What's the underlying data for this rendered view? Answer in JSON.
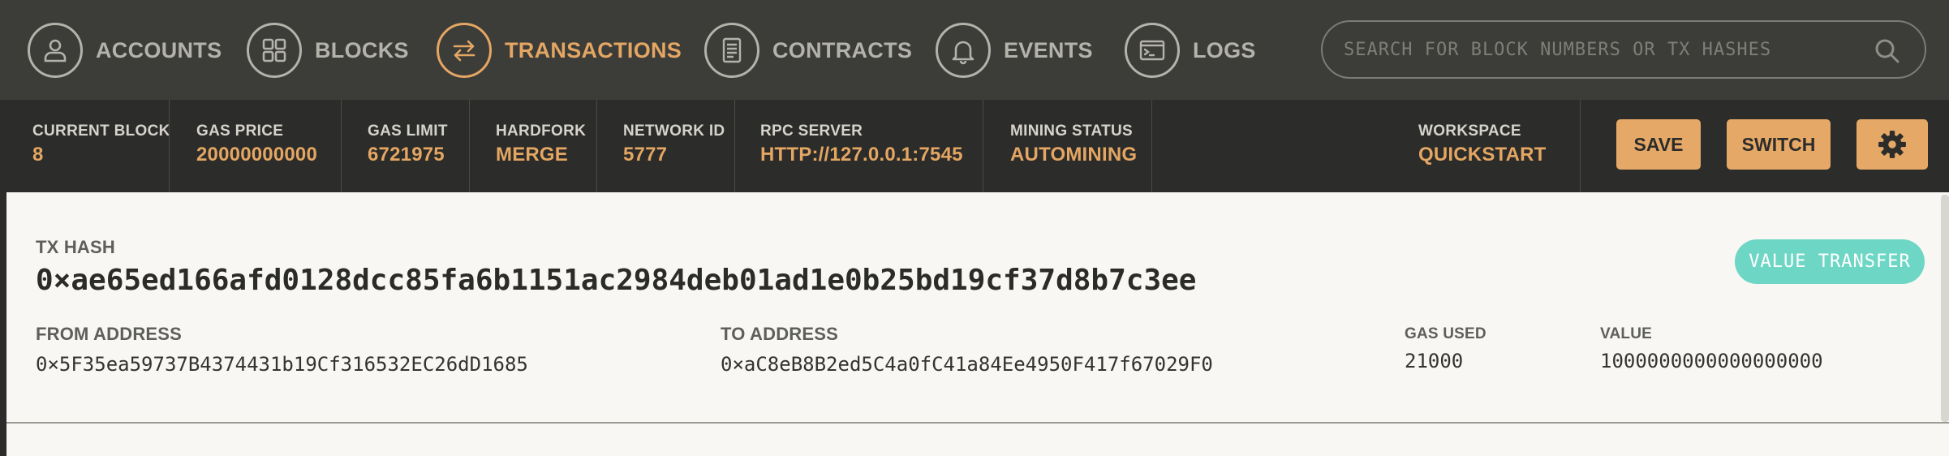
{
  "nav": {
    "items": [
      {
        "label": "ACCOUNTS",
        "icon": "person-icon",
        "active": false
      },
      {
        "label": "BLOCKS",
        "icon": "grid-icon",
        "active": false
      },
      {
        "label": "TRANSACTIONS",
        "icon": "swap-arrows-icon",
        "active": true
      },
      {
        "label": "CONTRACTS",
        "icon": "document-icon",
        "active": false
      },
      {
        "label": "EVENTS",
        "icon": "bell-icon",
        "active": false
      },
      {
        "label": "LOGS",
        "icon": "terminal-icon",
        "active": false
      }
    ],
    "search_placeholder": "SEARCH FOR BLOCK NUMBERS OR TX HASHES"
  },
  "status": {
    "current_block": {
      "label": "CURRENT BLOCK",
      "value": "8"
    },
    "gas_price": {
      "label": "GAS PRICE",
      "value": "20000000000"
    },
    "gas_limit": {
      "label": "GAS LIMIT",
      "value": "6721975"
    },
    "hardfork": {
      "label": "HARDFORK",
      "value": "MERGE"
    },
    "network_id": {
      "label": "NETWORK ID",
      "value": "5777"
    },
    "rpc_server": {
      "label": "RPC SERVER",
      "value": "HTTP://127.0.0.1:7545"
    },
    "mining_status": {
      "label": "MINING STATUS",
      "value": "AUTOMINING"
    },
    "workspace": {
      "label": "WORKSPACE",
      "value": "QUICKSTART"
    }
  },
  "buttons": {
    "save": "SAVE",
    "switch": "SWITCH"
  },
  "tx": {
    "hash_label": "TX HASH",
    "hash": "0×ae65ed166afd0128dcc85fa6b1151ac2984deb01ad1e0b25bd19cf37d8b7c3ee",
    "type_badge": "VALUE TRANSFER",
    "from_label": "FROM ADDRESS",
    "from": "0×5F35ea59737B4374431b19Cf316532EC26dD1685",
    "to_label": "TO ADDRESS",
    "to": "0×aC8eB8B2ed5C4a0fC41a84Ee4950F417f67029F0",
    "gas_used_label": "GAS USED",
    "gas_used": "21000",
    "value_label": "VALUE",
    "value": "1000000000000000000"
  },
  "colors": {
    "accent": "#e4a663",
    "nav_bg": "#3c3c39",
    "status_bg": "#2c2c2a",
    "badge": "#6ed6c4"
  }
}
